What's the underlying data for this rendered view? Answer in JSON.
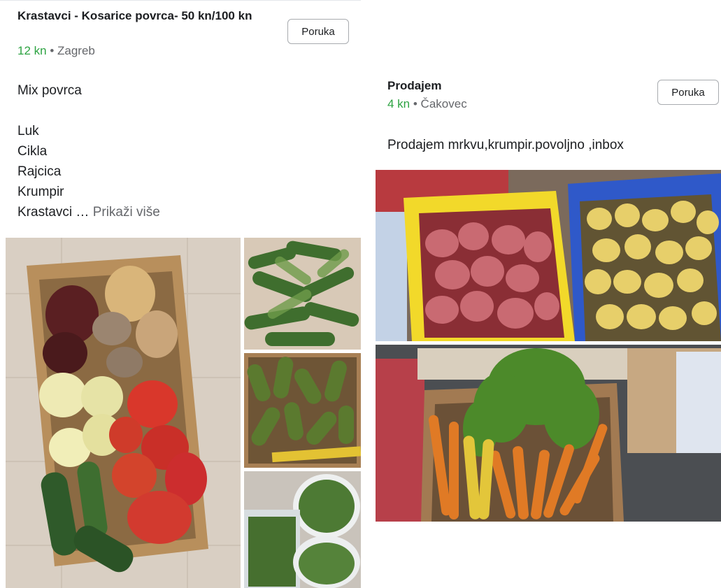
{
  "colors": {
    "price_green": "#2da342",
    "meta_gray": "#65676b",
    "button_border": "#a8abaf"
  },
  "post_left": {
    "title": "Krastavci - Kosarice povrca- 50 kn/100 kn",
    "price": "12 kn",
    "separator": " • ",
    "location": "Zagreb",
    "message_button": "Poruka",
    "description_lines": [
      "Mix povrca",
      "",
      "Luk",
      "Cikla",
      "Rajcica",
      "Krumpir",
      "Krastavci …"
    ],
    "see_more": "Prikaži više",
    "photos": {
      "main": "box of mixed vegetables: beetroot, onion, potatoes, peppers, tomatoes, cucumbers",
      "thumb_1": "pile of small cucumbers",
      "thumb_2": "box of pickling cucumbers with measuring tape",
      "thumb_3": "buckets of small cucumbers"
    }
  },
  "post_right": {
    "title": "Prodajem",
    "price": "4 kn",
    "separator": " • ",
    "location": "Čakovec",
    "message_button": "Poruka",
    "description": "Prodajem mrkvu,krumpir.povoljno ,inbox",
    "photos": {
      "top": "crates of red and yellow potatoes",
      "bottom": "box of fresh carrots with green tops"
    }
  }
}
